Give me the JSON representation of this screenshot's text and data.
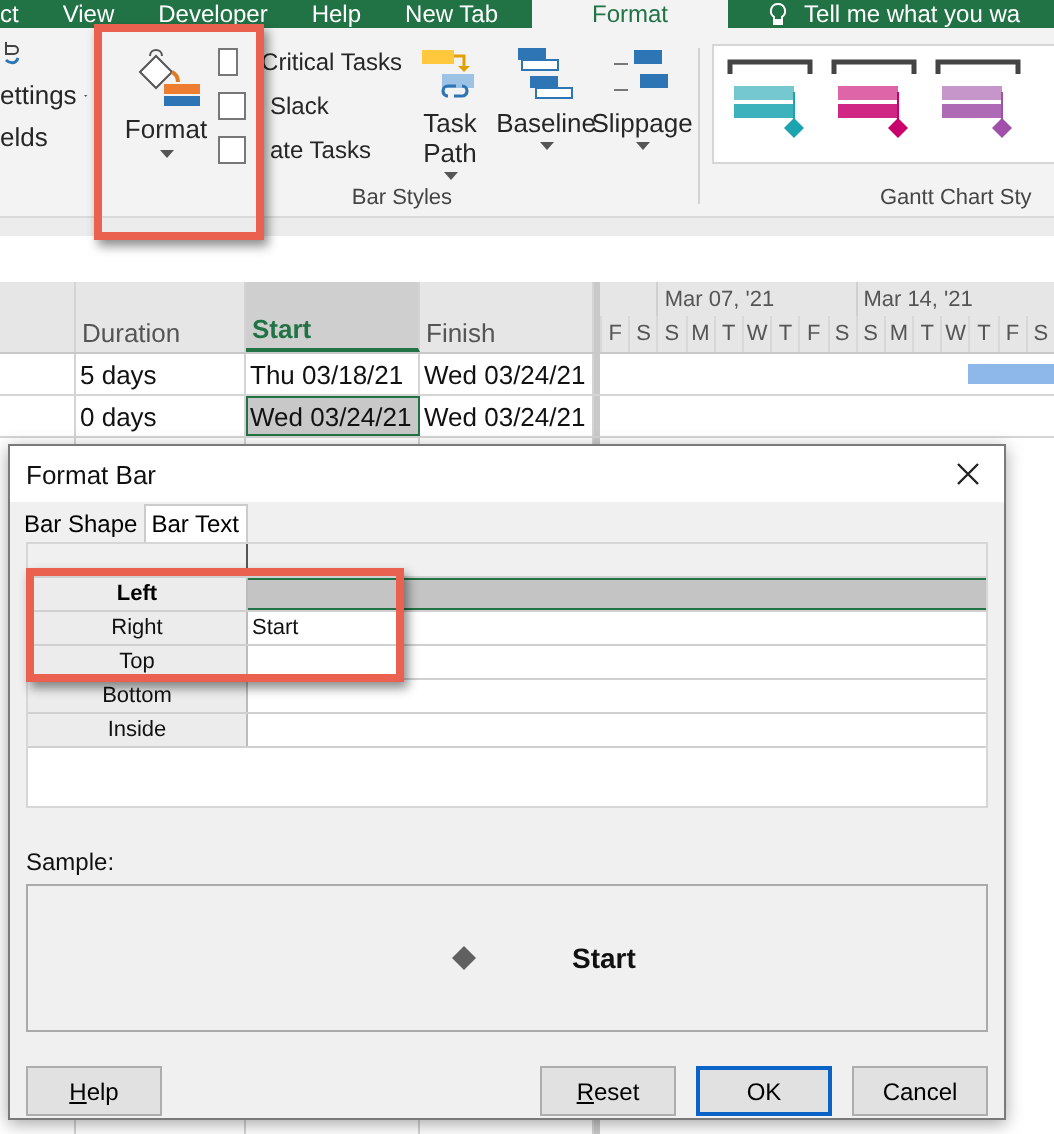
{
  "ribbon": {
    "tabs": [
      {
        "label": "ct",
        "selected": false
      },
      {
        "label": "View",
        "selected": false
      },
      {
        "label": "Developer",
        "selected": false
      },
      {
        "label": "Help",
        "selected": false
      },
      {
        "label": "New Tab",
        "selected": false
      },
      {
        "label": "Format",
        "selected": true
      }
    ],
    "tell_me": "Tell me what you wa",
    "partial_group": {
      "items": [
        {
          "label": "ettings",
          "dropdown": true
        },
        {
          "label": "elds",
          "dropdown": false
        }
      ]
    },
    "bar_styles": {
      "label": "Bar Styles",
      "highlighted": true,
      "format_button": {
        "label": "Format"
      },
      "checkboxes": [
        {
          "label": "Critical Tasks",
          "checked": false
        },
        {
          "label": "Slack",
          "checked": false
        },
        {
          "label": "ate Tasks",
          "checked": false
        }
      ],
      "buttons": [
        {
          "label": "Task Path",
          "kind": "task-path"
        },
        {
          "label": "Baseline",
          "kind": "baseline"
        },
        {
          "label": "Slippage",
          "kind": "slippage"
        }
      ]
    },
    "gantt_chart_styles": {
      "label": "Gantt Chart Sty",
      "styles": [
        {
          "color": "#1ba3b0"
        },
        {
          "color": "#c8006e"
        },
        {
          "color": "#a050a8"
        }
      ]
    }
  },
  "table": {
    "columns": [
      {
        "label": "Duration",
        "selected": false
      },
      {
        "label": "Start",
        "selected": true
      },
      {
        "label": "Finish",
        "selected": false
      }
    ],
    "timescale": {
      "weeks": [
        "Mar 07, '21",
        "Mar 14, '21"
      ],
      "days": [
        "F",
        "S",
        "S",
        "M",
        "T",
        "W",
        "T",
        "F",
        "S",
        "S",
        "M",
        "T",
        "W",
        "T",
        "F",
        "S"
      ]
    },
    "rows": [
      {
        "cells": [
          {
            "text": "5 days",
            "selected": false
          },
          {
            "text": "Thu 03/18/21",
            "selected": false
          },
          {
            "text": "Wed 03/24/21",
            "selected": false
          }
        ],
        "bar": true
      },
      {
        "cells": [
          {
            "text": "0 days",
            "selected": false
          },
          {
            "text": "Wed 03/24/21",
            "selected": true
          },
          {
            "text": "Wed 03/24/21",
            "selected": false
          }
        ],
        "bar": false
      }
    ]
  },
  "dialog": {
    "title": "Format Bar",
    "tabs": [
      {
        "label": "Bar Shape",
        "selected": false
      },
      {
        "label": "Bar Text",
        "selected": true
      }
    ],
    "positions_highlighted": true,
    "positions": [
      {
        "label": "Left",
        "selected": true
      },
      {
        "label": "Right",
        "value": "Start",
        "selected": false
      },
      {
        "label": "Top",
        "selected": false
      },
      {
        "label": "Bottom",
        "selected": false
      },
      {
        "label": "Inside",
        "selected": false
      }
    ],
    "sample_label": "Sample:",
    "sample_text": "Start",
    "buttons": [
      {
        "label": "Help",
        "underline_first": true,
        "default": false
      },
      {
        "label": "Reset",
        "underline_first": true,
        "default": false
      },
      {
        "label": "OK",
        "underline_first": false,
        "default": true
      },
      {
        "label": "Cancel",
        "underline_first": false,
        "default": false
      }
    ]
  }
}
